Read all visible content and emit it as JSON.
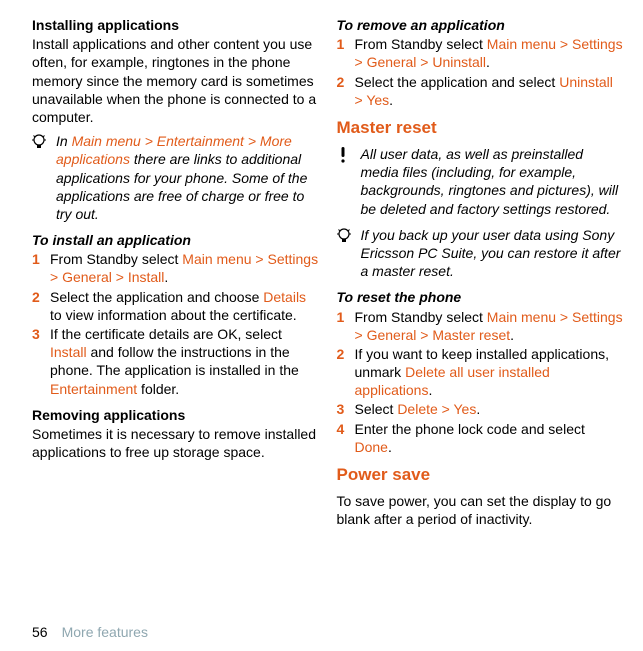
{
  "left": {
    "h_install_apps": "Installing applications",
    "install_apps_body": "Install applications and other content you use often, for example, ringtones in the phone memory since the memory card is sometimes unavailable when the phone is connected to a computer.",
    "tip1_pre": "In ",
    "tip1_nav": "Main menu > Entertainment > More applications",
    "tip1_post": " there are links to additional applications for your phone. Some of the applications are free of charge or free to try out.",
    "h_to_install": "To install an application",
    "step1_pre": "From Standby select ",
    "step1_nav": "Main menu > Settings > General > Install",
    "step1_post": ".",
    "step2_pre": "Select the application and choose ",
    "step2_nav": "Details",
    "step2_post": " to view information about the certificate.",
    "step3_pre": "If the certificate details are OK, select ",
    "step3_nav1": "Install",
    "step3_mid": " and follow the instructions in the phone. The application is installed in the ",
    "step3_nav2": "Entertainment",
    "step3_post": " folder.",
    "h_removing": "Removing applications",
    "removing_body": "Sometimes it is necessary to remove installed applications to free up storage space."
  },
  "right": {
    "h_to_remove": "To remove an application",
    "r1_pre": "From Standby select ",
    "r1_nav": "Main menu > Settings > General > Uninstall",
    "r1_post": ".",
    "r2_pre": "Select the application and select ",
    "r2_nav": "Uninstall > Yes",
    "r2_post": ".",
    "section_master": "Master reset",
    "warn_body": "All user data, as well as preinstalled media files (including, for example, backgrounds, ringtones and pictures), will be deleted and factory settings restored.",
    "tip2_body": "If you back up your user data using Sony Ericsson PC Suite, you can restore it after a master reset.",
    "h_to_reset": "To reset the phone",
    "rs1_pre": "From Standby select ",
    "rs1_nav": "Main menu > Settings > General > Master reset",
    "rs1_post": ".",
    "rs2_pre": "If you want to keep installed applications, unmark ",
    "rs2_nav": "Delete all user installed applications",
    "rs2_post": ".",
    "rs3_pre": "Select ",
    "rs3_nav": "Delete > Yes",
    "rs3_post": ".",
    "rs4_pre": "Enter the phone lock code and select ",
    "rs4_nav": "Done",
    "rs4_post": ".",
    "section_power": "Power save",
    "power_body": "To save power, you can set the display to go blank after a period of inactivity."
  },
  "footer": {
    "page": "56",
    "label": "More features"
  },
  "nums": {
    "n1": "1",
    "n2": "2",
    "n3": "3",
    "n4": "4"
  }
}
